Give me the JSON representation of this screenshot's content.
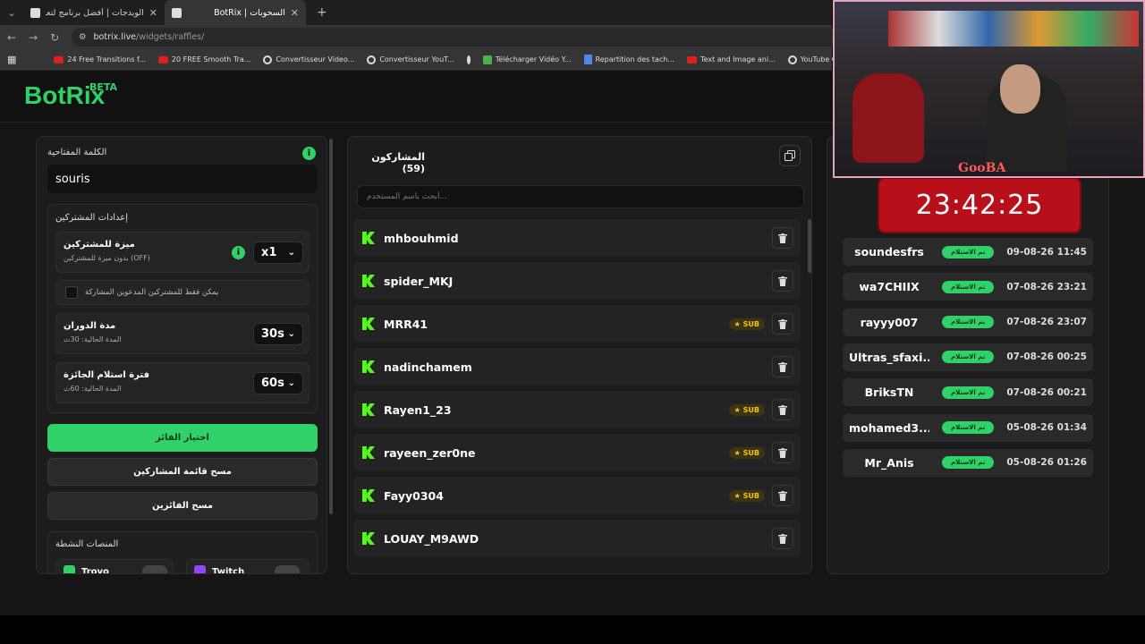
{
  "browser": {
    "tabs": [
      {
        "title": "الويدجات | أفضل برنامج لتعزيز البث"
      },
      {
        "title": "السحوبات | BotRix"
      }
    ],
    "url_domain": "botrix.live",
    "url_path": "/widgets/raffles/",
    "bookmarks": [
      "24 Free Transitions f...",
      "20 FREE Smooth Tra...",
      "Convertisseur Video...",
      "Convertisseur YouT...",
      "Télécharger Vidéo Y...",
      "Repartition des tach...",
      "Text and Image ani...",
      "YouTube Converter..."
    ]
  },
  "header": {
    "logo": "BotRix",
    "badge": "BETA"
  },
  "settings": {
    "keyword_label": "الكلمة المفتاحية",
    "keyword_value": "souris",
    "participants_settings_label": "إعدادات المشتركين",
    "sub_bonus_title": "ميزة للمشتركين",
    "sub_bonus_desc": "بدون ميزة للمشتركين (OFF)",
    "sub_bonus_value": "x1",
    "followers_only": "يمكن فقط للمشتركين المدعوين المشاركة",
    "spin_title": "مدة الدوران",
    "spin_desc": "المدة الحالية: 30ث",
    "spin_value": "30s",
    "claim_title": "فترة استلام الجائزة",
    "claim_desc": "المدة الحالية: 60ث",
    "claim_value": "60s",
    "pick_winner": "اختيار الفائز",
    "clear_participants": "مسح قائمة المشاركين",
    "clear_winners": "مسح الفائزين",
    "platforms_label": "المنصات النشطة",
    "platforms": [
      "Trovo",
      "Twitch"
    ]
  },
  "participants": {
    "title": "المشاركون (59)",
    "search_placeholder": "ابحث باسم المستخدم...",
    "sub_label": "SUB",
    "list": [
      {
        "name": "mhbouhmid",
        "sub": false
      },
      {
        "name": "spider_MKJ",
        "sub": false
      },
      {
        "name": "MRR41",
        "sub": true
      },
      {
        "name": "nadinchamem",
        "sub": false
      },
      {
        "name": "Rayen1_23",
        "sub": true
      },
      {
        "name": "rayeen_zer0ne",
        "sub": true
      },
      {
        "name": "Fayy0304",
        "sub": true
      },
      {
        "name": "LOUAY_M9AWD",
        "sub": false
      }
    ]
  },
  "winners": {
    "timer": "23:42:25",
    "status_label": "تم الاستلام",
    "list": [
      {
        "name": "soundesfrs",
        "date": "09-08-26 11:45"
      },
      {
        "name": "wa7CHIIX",
        "date": "07-08-26 23:21"
      },
      {
        "name": "rayyy007",
        "date": "07-08-26 23:07"
      },
      {
        "name": "Ultras_sfaxi...",
        "date": "07-08-26 00:25"
      },
      {
        "name": "BriksTN",
        "date": "07-08-26 00:21"
      },
      {
        "name": "mohamed3...",
        "date": "05-08-26 01:34"
      },
      {
        "name": "Mr_Anis",
        "date": "05-08-26 01:26"
      }
    ]
  },
  "webcam": {
    "overlay_name": "GooBA"
  },
  "colors": {
    "accent": "#2fd168",
    "timer_bg": "#b8101a",
    "kick": "#53fc18"
  }
}
